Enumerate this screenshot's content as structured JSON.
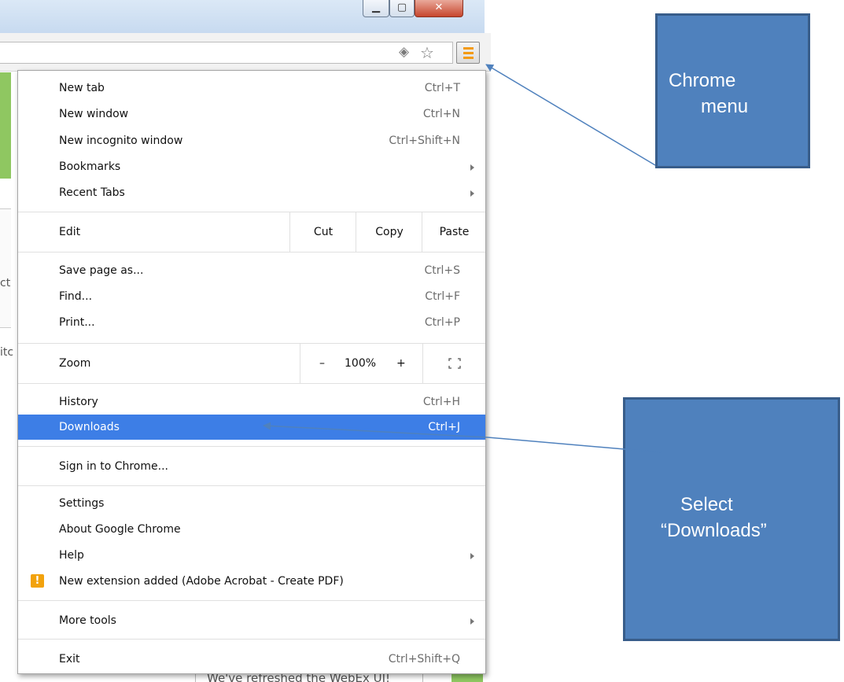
{
  "window": {
    "minimize_glyph": "▁",
    "maximize_glyph": "▢",
    "close_glyph": "✕"
  },
  "toolbar": {
    "extension_icon": "diamond-extension-icon",
    "bookmark_icon": "star-icon",
    "menu_icon": "hamburger-menu-icon",
    "menu_accent": "#f39a12"
  },
  "background": {
    "fragment_1": "ct",
    "fragment_2": "itc",
    "bottom_text": "We've refreshed the WebEx UI!"
  },
  "menu": {
    "new_tab": {
      "label": "New tab",
      "shortcut": "Ctrl+T"
    },
    "new_window": {
      "label": "New window",
      "shortcut": "Ctrl+N"
    },
    "new_incognito": {
      "label": "New incognito window",
      "shortcut": "Ctrl+Shift+N"
    },
    "bookmarks": {
      "label": "Bookmarks"
    },
    "recent_tabs": {
      "label": "Recent Tabs"
    },
    "edit": {
      "label": "Edit",
      "cut": "Cut",
      "copy": "Copy",
      "paste": "Paste"
    },
    "save_page": {
      "label": "Save page as...",
      "shortcut": "Ctrl+S"
    },
    "find": {
      "label": "Find...",
      "shortcut": "Ctrl+F"
    },
    "print": {
      "label": "Print...",
      "shortcut": "Ctrl+P"
    },
    "zoom": {
      "label": "Zoom",
      "minus": "–",
      "value": "100%",
      "plus": "+"
    },
    "history": {
      "label": "History",
      "shortcut": "Ctrl+H"
    },
    "downloads": {
      "label": "Downloads",
      "shortcut": "Ctrl+J"
    },
    "sign_in": {
      "label": "Sign in to Chrome..."
    },
    "settings": {
      "label": "Settings"
    },
    "about": {
      "label": "About Google Chrome"
    },
    "help": {
      "label": "Help"
    },
    "extension_added": {
      "label": "New extension added (Adobe Acrobat - Create PDF)",
      "icon": "!"
    },
    "more_tools": {
      "label": "More tools"
    },
    "exit": {
      "label": "Exit",
      "shortcut": "Ctrl+Shift+Q"
    }
  },
  "callouts": {
    "chrome_menu": {
      "line1": "Chrome",
      "line2": "menu"
    },
    "downloads": {
      "line1": "Select",
      "line2": "“Downloads”"
    }
  },
  "colors": {
    "highlight": "#3d7ee6",
    "callout_fill": "#4f81bd",
    "callout_border": "#385d8a",
    "warning": "#f2a20c"
  }
}
